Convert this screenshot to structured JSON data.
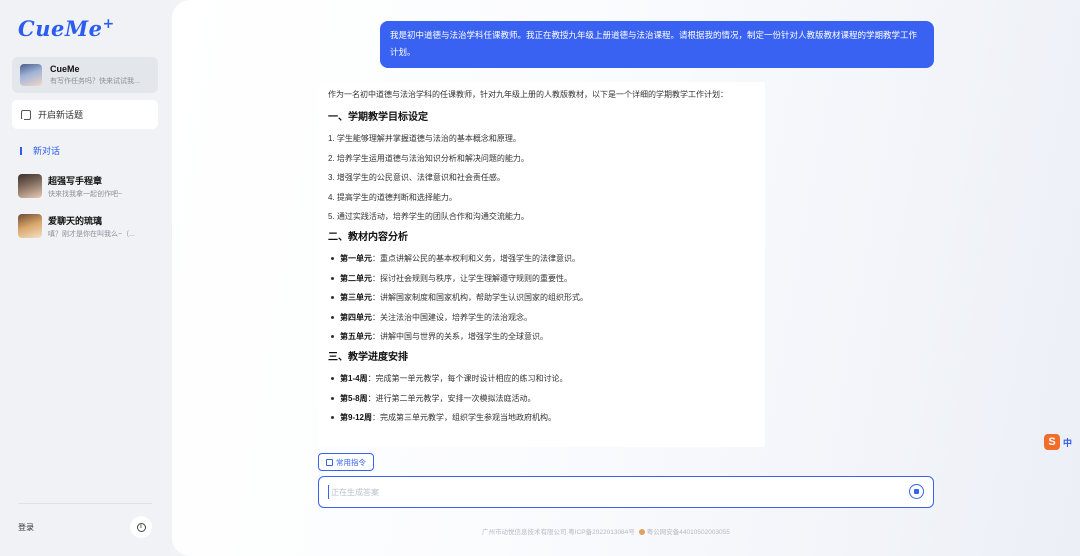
{
  "app": {
    "logo": "CueMe",
    "logo_plus": "+"
  },
  "sidebar": {
    "bot": {
      "name": "CueMe",
      "subtitle": "有写作任务吗？快来试试我..."
    },
    "new_topic_label": "开启新话题",
    "new_chat_label": "新对话",
    "conversations": [
      {
        "title": "超强写手程章",
        "subtitle": "快来找我拿一起创作吧~"
      },
      {
        "title": "爱聊天的琉璃",
        "subtitle": "嗔？刚才是你在叫我么~（..."
      }
    ],
    "login_label": "登录",
    "info_icon": "i"
  },
  "chat": {
    "user_message": "我是初中道德与法治学科任课教师。我正在教授九年级上册道德与法治课程。请根据我的情况，制定一份针对人教版教材课程的学期教学工作计划。",
    "answer": {
      "intro": "作为一名初中道德与法治学科的任课教师，针对九年级上册的人教版教材，以下是一个详细的学期教学工作计划：",
      "section1_title": "一、学期教学目标设定",
      "goals": [
        "1. 学生能够理解并掌握道德与法治的基本概念和原理。",
        "2. 培养学生运用道德与法治知识分析和解决问题的能力。",
        "3. 增强学生的公民意识、法律意识和社会责任感。",
        "4. 提高学生的道德判断和选择能力。",
        "5. 通过实践活动，培养学生的团队合作和沟通交流能力。"
      ],
      "section2_title": "二、教材内容分析",
      "units": [
        {
          "label": "第一单元",
          "text": "：重点讲解公民的基本权利和义务，增强学生的法律意识。"
        },
        {
          "label": "第二单元",
          "text": "：探讨社会规则与秩序，让学生理解遵守规则的重要性。"
        },
        {
          "label": "第三单元",
          "text": "：讲解国家制度和国家机构，帮助学生认识国家的组织形式。"
        },
        {
          "label": "第四单元",
          "text": "：关注法治中国建设，培养学生的法治观念。"
        },
        {
          "label": "第五单元",
          "text": "：讲解中国与世界的关系，增强学生的全球意识。"
        }
      ],
      "section3_title": "三、教学进度安排",
      "schedule": [
        {
          "label": "第1-4周",
          "text": "：完成第一单元教学，每个课时设计相应的练习和讨论。"
        },
        {
          "label": "第5-8周",
          "text": "：进行第二单元教学，安排一次模拟法庭活动。"
        },
        {
          "label": "第9-12周",
          "text": "：完成第三单元教学，组织学生参观当地政府机构。"
        }
      ]
    }
  },
  "composer": {
    "common_commands_label": "常用指令",
    "placeholder": "正在生成答案"
  },
  "footer": {
    "company": "广州市动悦信息技术有限公司 粤ICP备2022013084号",
    "police": "粤公网安备44010502003055"
  },
  "ime": {
    "logo": "S",
    "mode": "中"
  },
  "colors": {
    "accent": "#3a62f2",
    "sidebar_bg": "#f0f2f5"
  }
}
